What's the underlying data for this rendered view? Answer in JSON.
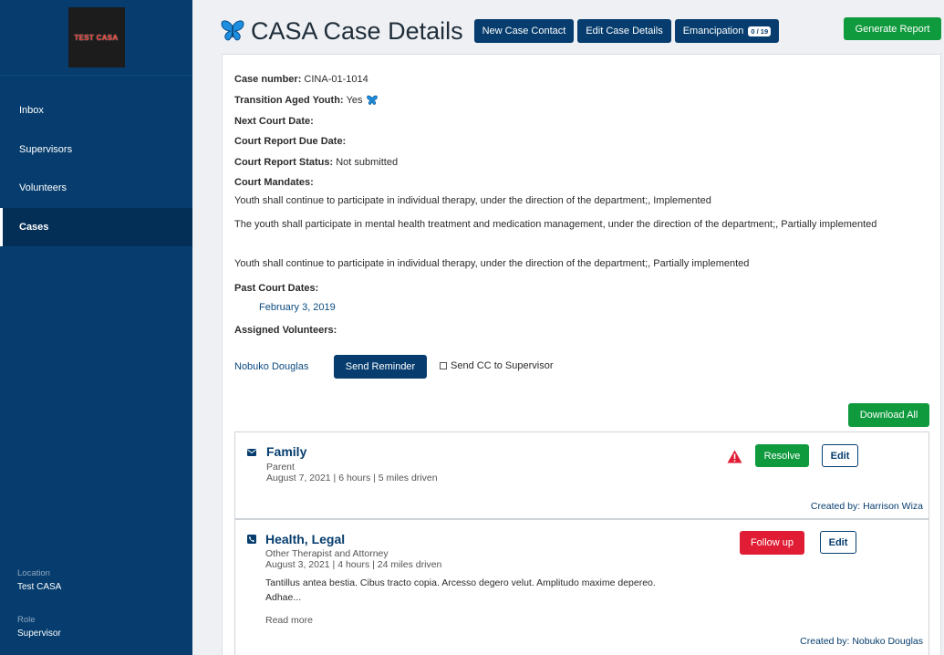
{
  "sidebar": {
    "logo_text": "TEST CASA",
    "nav": [
      {
        "label": "Inbox"
      },
      {
        "label": "Supervisors"
      },
      {
        "label": "Volunteers"
      },
      {
        "label": "Cases",
        "active": true
      }
    ],
    "location_label": "Location",
    "location_value": "Test CASA",
    "role_label": "Role",
    "role_value": "Supervisor"
  },
  "header": {
    "title": "CASA Case Details",
    "new_contact": "New Case Contact",
    "edit_details": "Edit Case Details",
    "emancipation": "Emancipation",
    "emancipation_badge": "0 / 19",
    "generate_report": "Generate Report"
  },
  "case": {
    "number_label": "Case number:",
    "number": "CINA-01-1014",
    "tay_label": "Transition Aged Youth:",
    "tay": "Yes",
    "next_court_label": "Next Court Date:",
    "report_due_label": "Court Report Due Date:",
    "report_status_label": "Court Report Status:",
    "report_status": "Not submitted",
    "mandates_label": "Court Mandates:",
    "mandates": [
      "Youth shall continue to participate in individual therapy, under the direction of the department;, Implemented",
      "The youth shall participate in mental health treatment and medication management, under the direction of the department;, Partially implemented",
      "Youth shall continue to participate in individual therapy, under the direction of the department;, Partially implemented"
    ],
    "past_dates_label": "Past Court Dates:",
    "past_date": "February 3, 2019",
    "assigned_label": "Assigned Volunteers:",
    "volunteer": "Nobuko Douglas",
    "send_reminder": "Send Reminder",
    "send_cc": "Send CC to Supervisor",
    "download_all": "Download All"
  },
  "contacts": [
    {
      "title": "Family",
      "subtitle": "Parent",
      "details": "August 7, 2021 | 6 hours | 5 miles driven",
      "action": "Resolve",
      "edit": "Edit",
      "created": "Created by: Harrison Wiza",
      "icon": "envelope-icon"
    },
    {
      "title": "Health, Legal",
      "subtitle": "Other Therapist and Attorney",
      "details": "August 3, 2021 | 4 hours | 24 miles driven",
      "notes": "Tantillus antea bestia. Cibus tracto copia. Arcesso degero velut. Amplitudo maxime depereo. Adhae...",
      "read_more": "Read more",
      "action": "Follow up",
      "edit": "Edit",
      "created": "Created by: Nobuko Douglas",
      "icon": "phone-icon"
    }
  ],
  "colors": {
    "navy": "#063d6e",
    "green": "#0f9a3d",
    "red": "#e11d35",
    "butterfly": "#1d8fe0"
  }
}
